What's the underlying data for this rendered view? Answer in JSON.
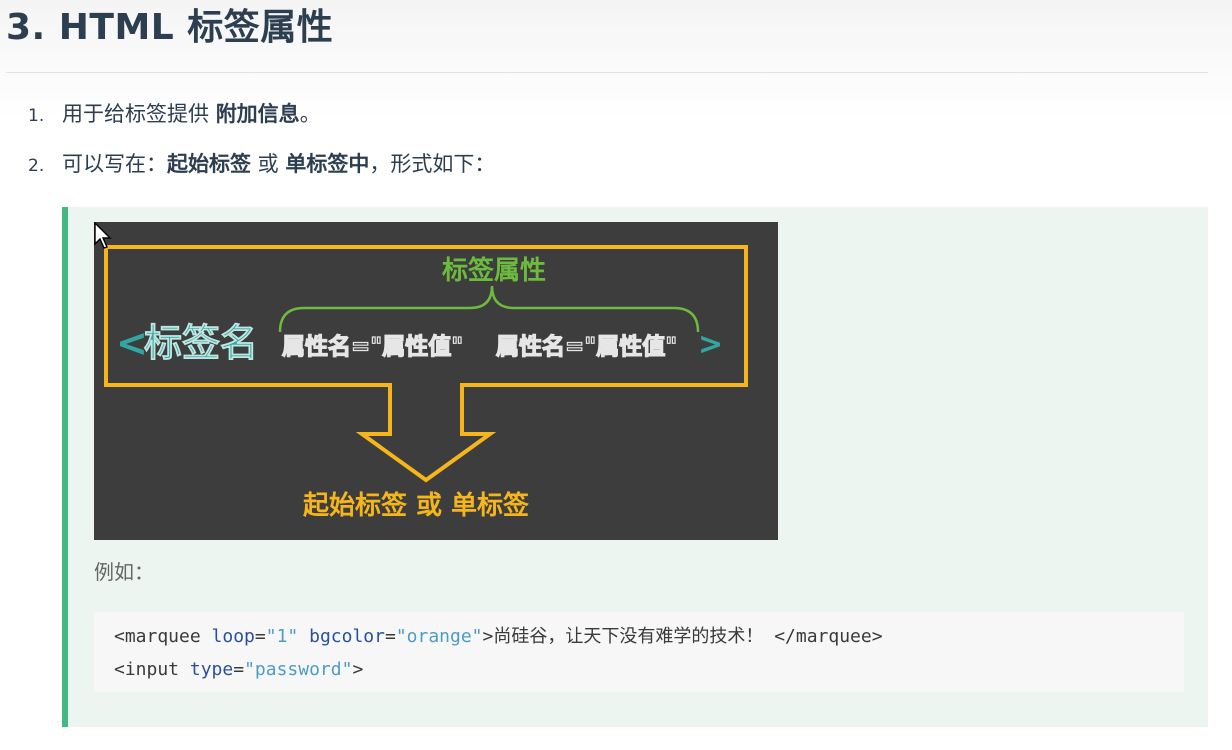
{
  "heading": "3. HTML 标签属性",
  "list": [
    {
      "num": "1.",
      "pre": "用于给标签提供 ",
      "bold": "附加信息",
      "post": "。"
    },
    {
      "num": "2.",
      "pre": "可以写在：",
      "bold1": "起始标签",
      "mid": " 或 ",
      "bold2": "单标签中",
      "post": "，形式如下："
    }
  ],
  "diagram": {
    "attr_label": "标签属性",
    "open": "<",
    "tag_name": "标签名",
    "pair1": "属性名=\"属性值\"",
    "pair2": "属性名=\"属性值\"",
    "close": ">",
    "bottom_label": "起始标签 或 单标签",
    "colors": {
      "background": "#3d3d3d",
      "frame": "#f5b51b",
      "brace": "#6dbb3e",
      "tag": "#34a6a0",
      "attr_text": "#e6e6e6"
    }
  },
  "example_label": "例如：",
  "code": {
    "line1": {
      "open": "<marquee ",
      "attr1": "loop",
      "eq1": "=",
      "val1": "\"1\"",
      "sp": " ",
      "attr2": "bgcolor",
      "eq2": "=",
      "val2": "\"orange\"",
      "gt": ">",
      "text": "尚硅谷，让天下没有难学的技术！",
      "close": " </marquee>"
    },
    "line2": {
      "open": "<input ",
      "attr1": "type",
      "eq1": "=",
      "val1": "\"password\"",
      "gt": ">"
    }
  }
}
